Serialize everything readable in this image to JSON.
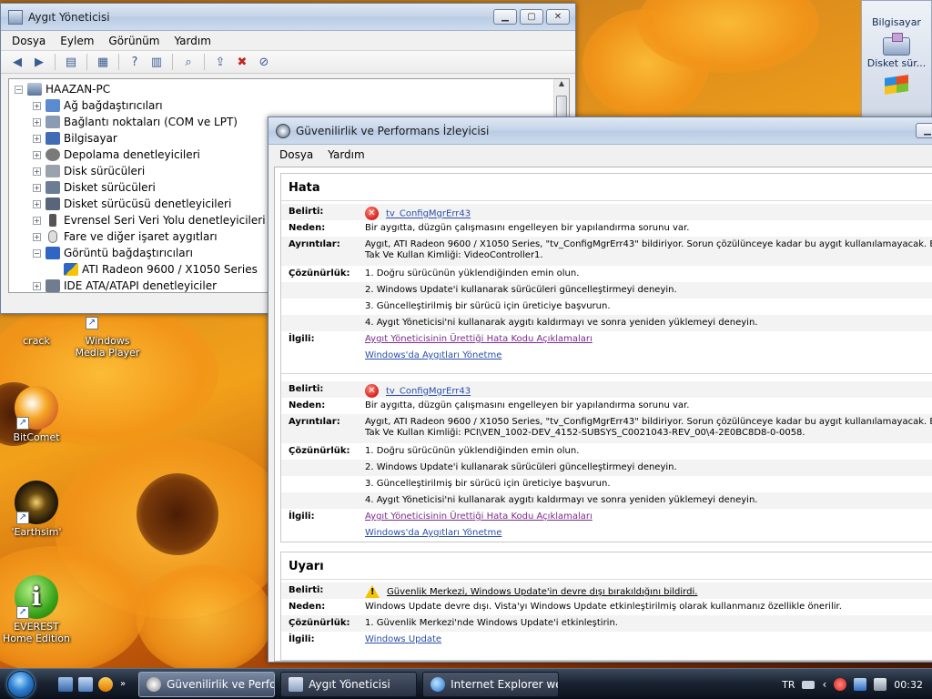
{
  "desktop": {
    "icons": [
      {
        "label": "crack"
      },
      {
        "label": "Windows Media Player"
      },
      {
        "label": "BitComet"
      },
      {
        "label": "'Earthsim'"
      },
      {
        "label": "EVEREST Home Edition"
      }
    ],
    "gadget": {
      "title": "Bilgisayar",
      "item": "Disket sür..."
    }
  },
  "device_manager": {
    "title": "Aygıt Yöneticisi",
    "menu": [
      "Dosya",
      "Eylem",
      "Görünüm",
      "Yardım"
    ],
    "tree": {
      "root": "HAAZAN-PC",
      "nodes": [
        "Ağ bağdaştırıcıları",
        "Bağlantı noktaları (COM ve LPT)",
        "Bilgisayar",
        "Depolama denetleyicileri",
        "Disk sürücüleri",
        "Disket sürücüleri",
        "Disket sürücüsü denetleyicileri",
        "Evrensel Seri Veri Yolu denetleyicileri",
        "Fare ve diğer işaret aygıtları",
        "Görüntü bağdaştırıcıları",
        "ATI Radeon 9600 / X1050 Series",
        "IDE ATA/ATAPI denetleyiciler"
      ]
    }
  },
  "reliability": {
    "title": "Güvenilirlik ve Performans İzleyicisi",
    "menu": [
      "Dosya",
      "Yardım"
    ],
    "labels": {
      "symptom": "Belirti:",
      "cause": "Neden:",
      "details": "Ayrıntılar:",
      "resolution": "Çözünürlük:",
      "related": "İlgili:"
    },
    "error_section": {
      "heading": "Hata",
      "entries": [
        {
          "symptom": "tv_ConfigMgrErr43",
          "cause": "Bir aygıtta, düzgün çalışmasını engelleyen bir yapılandırma sorunu var.",
          "details_1": "Aygıt, ATI Radeon 9600 / X1050 Series, \"tv_ConfigMgrErr43\" bildiriyor. Sorun çözülünceye kadar bu aygıt kullanılamayacak. Bu a",
          "details_2": "Tak Ve Kullan Kimliği: VideoController1.",
          "steps": [
            "1. Doğru sürücünün yüklendiğinden emin olun.",
            "2. Windows Update'i kullanarak sürücüleri güncelleştirmeyi deneyin.",
            "3. Güncelleştirilmiş bir sürücü için üreticiye başvurun.",
            "4. Aygıt Yöneticisi'ni kullanarak aygıtı kaldırmayı ve sonra yeniden yüklemeyi deneyin."
          ],
          "related_1": "Aygıt Yöneticisinin Ürettiği Hata Kodu Açıklamaları",
          "related_2": "Windows'da Aygıtları Yönetme"
        },
        {
          "symptom": "tv_ConfigMgrErr43",
          "cause": "Bir aygıtta, düzgün çalışmasını engelleyen bir yapılandırma sorunu var.",
          "details_1": "Aygıt, ATI Radeon 9600 / X1050 Series, \"tv_ConfigMgrErr43\" bildiriyor. Sorun çözülünceye kadar bu aygıt kullanılamayacak. Bu a",
          "details_2": "Tak Ve Kullan Kimliği: PCI\\VEN_1002-DEV_4152-SUBSYS_C0021043-REV_00\\4-2E0BC8D8-0-0058.",
          "steps": [
            "1. Doğru sürücünün yüklendiğinden emin olun.",
            "2. Windows Update'i kullanarak sürücüleri güncelleştirmeyi deneyin.",
            "3. Güncelleştirilmiş bir sürücü için üreticiye başvurun.",
            "4. Aygıt Yöneticisi'ni kullanarak aygıtı kaldırmayı ve sonra yeniden yüklemeyi deneyin."
          ],
          "related_1": "Aygıt Yöneticisinin Ürettiği Hata Kodu Açıklamaları",
          "related_2": "Windows'da Aygıtları Yönetme"
        }
      ]
    },
    "warning_section": {
      "heading": "Uyarı",
      "symptom": "Güvenlik Merkezi, Windows Update'in devre dışı bırakıldığını bildirdi.",
      "cause": "Windows Update devre dışı. Vista'yı Windows Update etkinleştirilmiş olarak kullanmanız özellikle önerilir.",
      "resolution": "1. Güvenlik Merkezi'nde Windows Update'i etkinleştirin.",
      "related": "Windows Update"
    }
  },
  "taskbar": {
    "tasks": [
      {
        "label": "Güvenilirlik ve Perfo..."
      },
      {
        "label": "Aygıt Yöneticisi"
      },
      {
        "label": "Internet Explorer we..."
      }
    ],
    "quicklaunch_more": "»",
    "language": "TR",
    "clock": "00:32"
  },
  "colors": {
    "link": "#2a4fa8",
    "visited_link": "#7a2a8a",
    "error": "#d81f1f",
    "warning": "#f5c400"
  }
}
